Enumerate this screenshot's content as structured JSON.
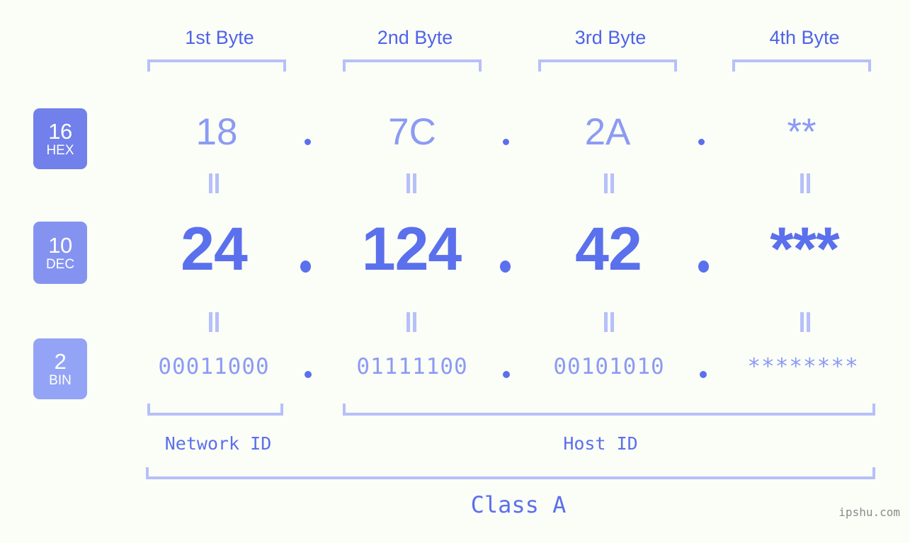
{
  "background_color": "#fbfdf7",
  "accent_color": "#5a70ec",
  "light_accent_color": "#8b9bf3",
  "bracket_color": "#b6c0f9",
  "byte_headers": [
    {
      "label": "1st Byte"
    },
    {
      "label": "2nd Byte"
    },
    {
      "label": "3rd Byte"
    },
    {
      "label": "4th Byte"
    }
  ],
  "rows": [
    {
      "base": "16",
      "base_name": "HEX",
      "badge_color": "#7180ea",
      "values": [
        "18",
        "7C",
        "2A",
        "**"
      ]
    },
    {
      "base": "10",
      "base_name": "DEC",
      "badge_color": "#8593f0",
      "values": [
        "24",
        "124",
        "42",
        "***"
      ]
    },
    {
      "base": "2",
      "base_name": "BIN",
      "badge_color": "#93a4f6",
      "values": [
        "00011000",
        "01111100",
        "00101010",
        "********"
      ]
    }
  ],
  "separators": {
    "dot": "."
  },
  "equals_symbol": "=",
  "sections": [
    {
      "label": "Network ID"
    },
    {
      "label": "Host ID"
    }
  ],
  "class_label": "Class A",
  "watermark": "ipshu.com"
}
